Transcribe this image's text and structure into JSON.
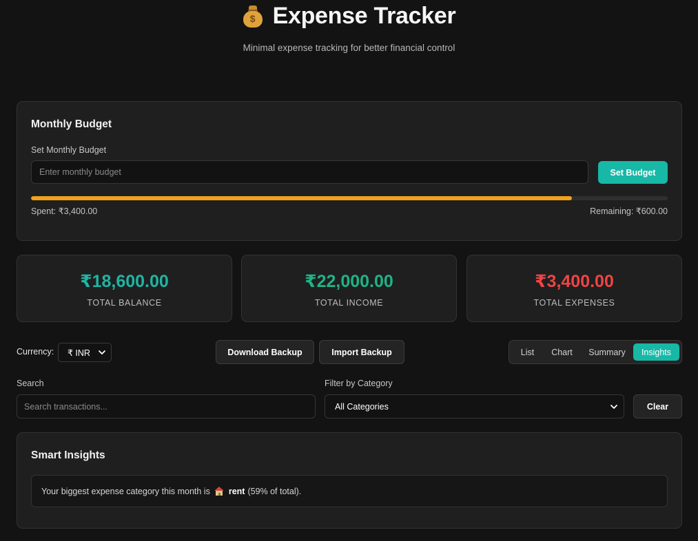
{
  "header": {
    "icon": "money-bag-icon",
    "title": "Expense Tracker",
    "subtitle": "Minimal expense tracking for better financial control"
  },
  "budget": {
    "heading": "Monthly Budget",
    "label": "Set Monthly Budget",
    "input_placeholder": "Enter monthly budget",
    "input_value": "",
    "button_label": "Set Budget",
    "progress_fraction": 0.85,
    "spent_text": "Spent: ₹3,400.00",
    "remaining_text": "Remaining: ₹600.00"
  },
  "stats": [
    {
      "value": "₹18,600.00",
      "label": "TOTAL BALANCE",
      "color": "#1fb5a3"
    },
    {
      "value": "₹22,000.00",
      "label": "TOTAL INCOME",
      "color": "#1fb386"
    },
    {
      "value": "₹3,400.00",
      "label": "TOTAL EXPENSES",
      "color": "#ef4444"
    }
  ],
  "toolbar": {
    "currency_label": "Currency:",
    "currency_value": "₹ INR",
    "download_label": "Download Backup",
    "import_label": "Import Backup",
    "views": [
      "List",
      "Chart",
      "Summary",
      "Insights"
    ],
    "active_view": "Insights"
  },
  "filters": {
    "search_label": "Search",
    "search_placeholder": "Search transactions...",
    "search_value": "",
    "category_label": "Filter by Category",
    "category_value": "All Categories",
    "clear_label": "Clear"
  },
  "insights": {
    "heading": "Smart Insights",
    "text_before": "Your biggest expense category this month is",
    "category_icon": "house-icon",
    "category": "rent",
    "text_after": "(59% of total)."
  },
  "colors": {
    "accent": "#17b8a6",
    "progress": "#f0a21c",
    "background": "#131313",
    "card": "#1f1f1f"
  }
}
